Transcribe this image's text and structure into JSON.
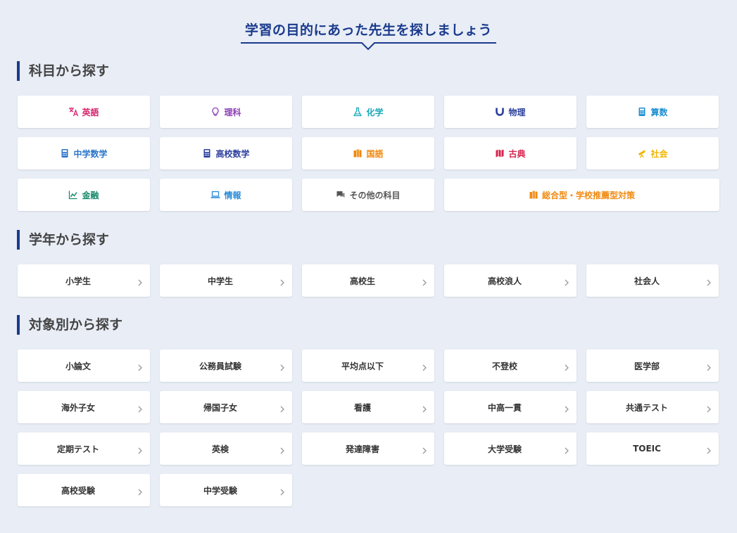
{
  "main_title": "学習の目的にあった先生を探しましょう",
  "sections": {
    "subject": {
      "heading": "科目から探す",
      "items": [
        {
          "label": "英語",
          "icon": "translate-icon",
          "color": "#d6246e"
        },
        {
          "label": "理科",
          "icon": "lightbulb-icon",
          "color": "#8b3fb5"
        },
        {
          "label": "化学",
          "icon": "flask-icon",
          "color": "#19a9b8"
        },
        {
          "label": "物理",
          "icon": "magnet-icon",
          "color": "#2c3f9e"
        },
        {
          "label": "算数",
          "icon": "calculator-icon",
          "color": "#1d8fd1"
        },
        {
          "label": "中学数学",
          "icon": "calculator-icon",
          "color": "#2a76c9"
        },
        {
          "label": "高校数学",
          "icon": "calculator-icon",
          "color": "#2c3f9e"
        },
        {
          "label": "国語",
          "icon": "books-icon",
          "color": "#f08a12"
        },
        {
          "label": "古典",
          "icon": "map-icon",
          "color": "#d6244e"
        },
        {
          "label": "社会",
          "icon": "telescope-icon",
          "color": "#f0b400"
        },
        {
          "label": "金融",
          "icon": "chart-icon",
          "color": "#168a6a"
        },
        {
          "label": "情報",
          "icon": "laptop-icon",
          "color": "#2a8ad6"
        },
        {
          "label": "その他の科目",
          "icon": "chat-icon",
          "color": "#555555"
        },
        {
          "label": "総合型・学校推薦型対策",
          "icon": "books-icon",
          "color": "#f08a12"
        }
      ]
    },
    "grade": {
      "heading": "学年から探す",
      "items": [
        "小学生",
        "中学生",
        "高校生",
        "高校浪人",
        "社会人"
      ]
    },
    "purpose": {
      "heading": "対象別から探す",
      "items": [
        "小論文",
        "公務員試験",
        "平均点以下",
        "不登校",
        "医学部",
        "海外子女",
        "帰国子女",
        "看護",
        "中高一貫",
        "共通テスト",
        "定期テスト",
        "英検",
        "発達障害",
        "大学受験",
        "TOEIC",
        "高校受験",
        "中学受験"
      ]
    }
  }
}
